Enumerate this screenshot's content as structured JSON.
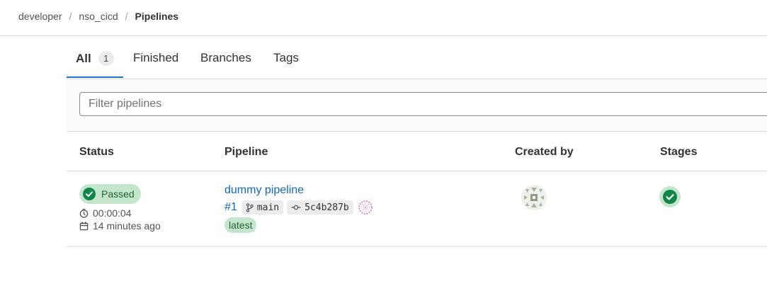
{
  "breadcrumb": {
    "items": [
      "developer",
      "nso_cicd",
      "Pipelines"
    ],
    "separator": "/"
  },
  "tabs": [
    {
      "label": "All",
      "count": "1",
      "active": true
    },
    {
      "label": "Finished"
    },
    {
      "label": "Branches"
    },
    {
      "label": "Tags"
    }
  ],
  "filter": {
    "placeholder": "Filter pipelines"
  },
  "table": {
    "headers": {
      "status": "Status",
      "pipeline": "Pipeline",
      "created_by": "Created by",
      "stages": "Stages"
    },
    "rows": [
      {
        "status": {
          "label": "Passed",
          "duration": "00:00:04",
          "finished": "14 minutes ago"
        },
        "pipeline": {
          "name": "dummy pipeline",
          "id": "#1",
          "branch": "main",
          "commit": "5c4b287b",
          "badge": "latest"
        },
        "stages": [
          "passed"
        ]
      }
    ]
  },
  "colors": {
    "success": "#108548",
    "success_bg": "#c3e6cd",
    "link": "#1068bf",
    "active_tab": "#1f75cb"
  },
  "icons": [
    "clock-icon",
    "calendar-icon",
    "branch-icon",
    "commit-icon",
    "check-circle-icon",
    "avatar-icon"
  ]
}
